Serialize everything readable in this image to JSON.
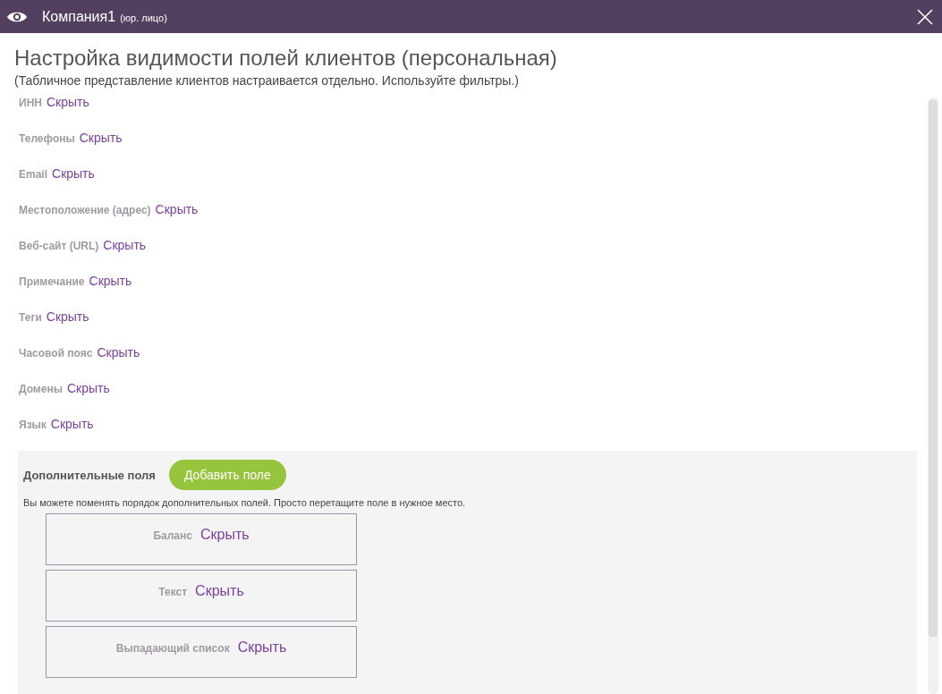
{
  "window": {
    "title": "Компания1",
    "subtitle": "(юр. лицо)"
  },
  "heading": "Настройка видимости полей клиентов (персональная)",
  "note": "(Табличное представление клиентов настраивается отдельно. Используйте фильтры.)",
  "fields": [
    {
      "label": "ИНН",
      "action": "Скрыть"
    },
    {
      "label": "Телефоны",
      "action": "Скрыть"
    },
    {
      "label": "Email",
      "action": "Скрыть"
    },
    {
      "label": "Местоположение (адрес)",
      "action": "Скрыть"
    },
    {
      "label": "Веб-сайт (URL)",
      "action": "Скрыть"
    },
    {
      "label": "Примечание",
      "action": "Скрыть"
    },
    {
      "label": "Теги",
      "action": "Скрыть"
    },
    {
      "label": "Часовой пояс",
      "action": "Скрыть"
    },
    {
      "label": "Домены",
      "action": "Скрыть"
    },
    {
      "label": "Язык",
      "action": "Скрыть"
    }
  ],
  "custom_fields": {
    "title": "Дополнительные поля",
    "add_button": "Добавить поле",
    "hint": "Вы можете поменять порядок дополнительных полей. Просто перетащите поле в нужное место.",
    "items": [
      {
        "label": "Баланс",
        "action": "Скрыть"
      },
      {
        "label": "Текст",
        "action": "Скрыть"
      },
      {
        "label": "Выпадающий список",
        "action": "Скрыть"
      }
    ]
  }
}
